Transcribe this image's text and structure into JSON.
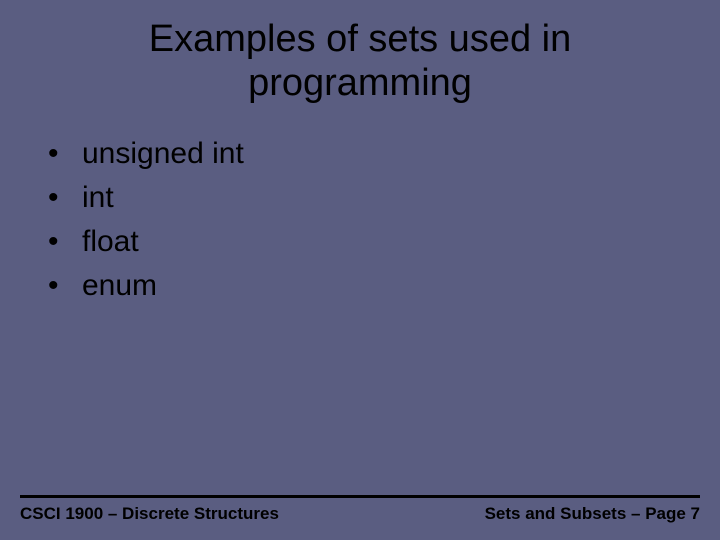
{
  "title_line1": "Examples of sets used in",
  "title_line2": "programming",
  "bullets": {
    "b0": "unsigned int",
    "b1": "int",
    "b2": "float",
    "b3": "enum"
  },
  "footer": {
    "left": "CSCI 1900 – Discrete Structures",
    "right": "Sets and Subsets – Page 7"
  }
}
